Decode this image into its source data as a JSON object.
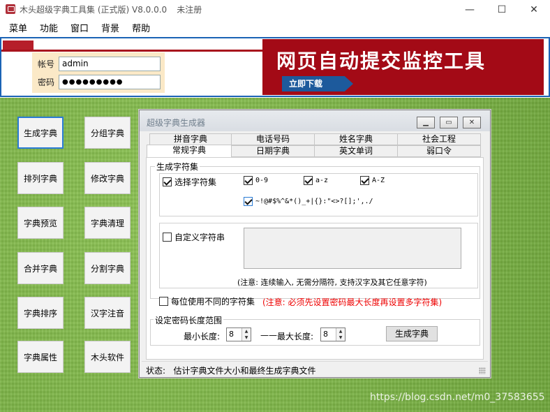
{
  "window": {
    "title": "木头超级字典工具集 (正式版) V8.0.0.0",
    "registration": "未注册",
    "minimize_glyph": "—",
    "maximize_glyph": "☐",
    "close_glyph": "✕"
  },
  "menu": [
    "菜单",
    "功能",
    "窗口",
    "背景",
    "帮助"
  ],
  "login": {
    "account_label": "帐号",
    "account_value": "admin",
    "password_label": "密码",
    "password_value": "●●●●●●●●●"
  },
  "banner": {
    "title": "网页自动提交监控工具",
    "button": "立即下载"
  },
  "sidebar": {
    "left": [
      "生成字典",
      "排列字典",
      "字典预览",
      "合并字典",
      "字典排序",
      "字典属性"
    ],
    "right": [
      "分组字典",
      "修改字典",
      "字典清理",
      "分割字典",
      "汉字注音",
      "木头软件"
    ]
  },
  "dialog": {
    "title": "超级字典生成器",
    "tabs_row1": [
      "拼音字典",
      "电话号码",
      "姓名字典",
      "社会工程"
    ],
    "tabs_row2": [
      "常规字典",
      "日期字典",
      "英文单词",
      "弱口令"
    ],
    "charset_group_title": "生成字符集",
    "select_charset": "选择字符集",
    "opt_digits": "0-9",
    "opt_lower": "a-z",
    "opt_upper": "A-Z",
    "opt_symbols": "~!@#$%^&*()_+|{}:\"<>?[];',./",
    "custom_charset": "自定义字符串",
    "custom_note": "(注意: 连续输入, 无需分隔符, 支持汉字及其它任意字符)",
    "each_diff": "每位使用不同的字符集",
    "each_diff_note": "(注意: 必须先设置密码最大长度再设置多字符集)",
    "length_group_title": "设定密码长度范围",
    "min_label": "最小长度:",
    "min_value": "8",
    "dash": "——",
    "max_label": "最大长度:",
    "max_value": "8",
    "generate_button": "生成字典",
    "status_label": "状态:",
    "status_text": "估计字典文件大小和最终生成字典文件"
  },
  "watermark": "https://blog.csdn.net/m0_37583655"
}
